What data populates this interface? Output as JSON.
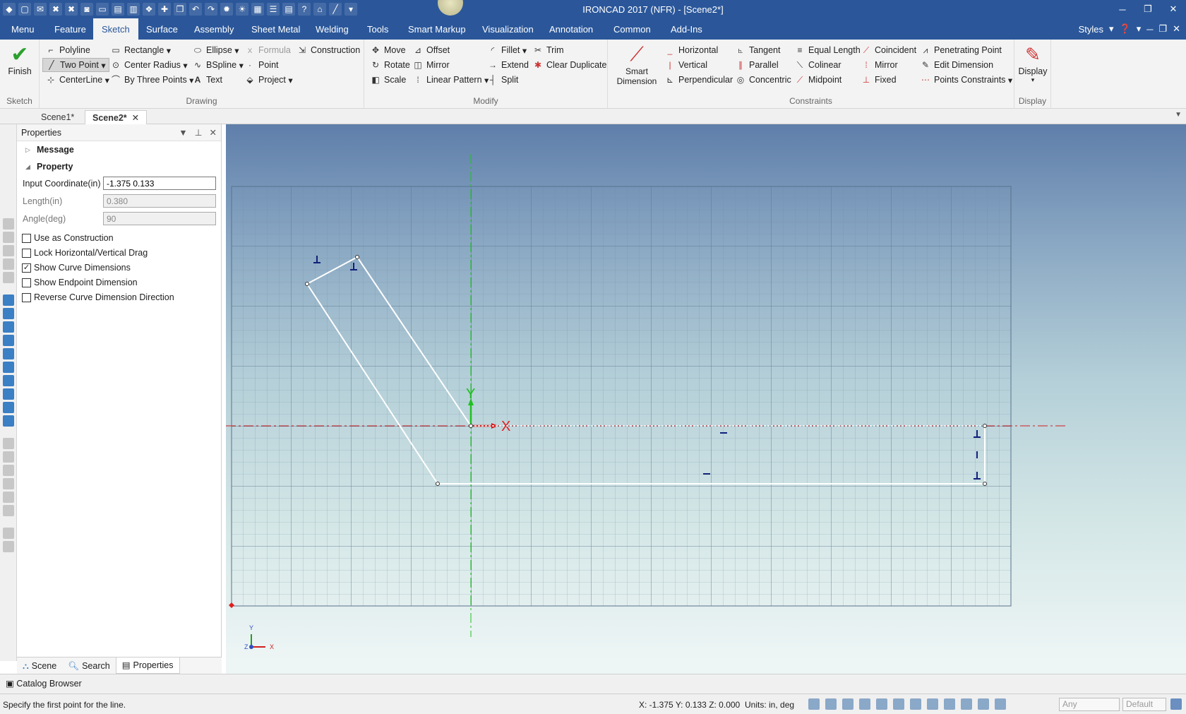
{
  "window": {
    "title": "IRONCAD 2017 (NFR) - [Scene2*]"
  },
  "menu": {
    "tabs": [
      "Menu",
      "Feature",
      "Sketch",
      "Surface",
      "Assembly",
      "Sheet Metal",
      "Welding",
      "Tools",
      "Smart Markup",
      "Visualization",
      "Annotation",
      "Common",
      "Add-Ins"
    ],
    "active": "Sketch",
    "styles_label": "Styles"
  },
  "ribbon": {
    "sketch_group": {
      "finish": "Finish",
      "label": "Sketch"
    },
    "drawing": {
      "polyline": "Polyline",
      "two_point": "Two Point",
      "centerline": "CenterLine",
      "rectangle": "Rectangle",
      "center_radius": "Center Radius",
      "by_three_points": "By Three Points",
      "ellipse": "Ellipse",
      "bspline": "BSpline",
      "text": "Text",
      "formula": "Formula",
      "point": "Point",
      "project": "Project",
      "construction": "Construction",
      "label": "Drawing"
    },
    "modify": {
      "move": "Move",
      "rotate": "Rotate",
      "scale": "Scale",
      "offset": "Offset",
      "mirror": "Mirror",
      "linear_pattern": "Linear Pattern",
      "fillet": "Fillet",
      "extend": "Extend",
      "split": "Split",
      "trim": "Trim",
      "clear_duplicate": "Clear Duplicate",
      "label": "Modify"
    },
    "constraints": {
      "smart_dimension": "Smart Dimension",
      "horizontal": "Horizontal",
      "vertical": "Vertical",
      "perpendicular": "Perpendicular",
      "tangent": "Tangent",
      "parallel": "Parallel",
      "concentric": "Concentric",
      "equal_length": "Equal Length",
      "colinear": "Colinear",
      "midpoint": "Midpoint",
      "coincident": "Coincident",
      "mirror": "Mirror",
      "fixed": "Fixed",
      "penetrating_point": "Penetrating Point",
      "edit_dimension": "Edit Dimension",
      "points_constraints": "Points Constraints",
      "label": "Constraints"
    },
    "display": {
      "display": "Display",
      "label": "Display"
    }
  },
  "doc_tabs": [
    "Scene1*",
    "Scene2*"
  ],
  "properties": {
    "title": "Properties",
    "message_section": "Message",
    "property_section": "Property",
    "fields": [
      {
        "label": "Input Coordinate(in)",
        "value": "-1.375 0.133",
        "enabled": true
      },
      {
        "label": "Length(in)",
        "value": "0.380",
        "enabled": false
      },
      {
        "label": "Angle(deg)",
        "value": "90",
        "enabled": false
      }
    ],
    "checkboxes": [
      {
        "label": "Use as Construction",
        "checked": false
      },
      {
        "label": "Lock Horizontal/Vertical Drag",
        "checked": false
      },
      {
        "label": "Show Curve Dimensions",
        "checked": true
      },
      {
        "label": "Show Endpoint Dimension",
        "checked": false
      },
      {
        "label": "Reverse Curve Dimension Direction",
        "checked": false
      }
    ],
    "bottom_tabs": [
      "Scene",
      "Search",
      "Properties"
    ]
  },
  "viewport": {
    "x_axis_label": "X",
    "y_axis_label": "Y",
    "triad": {
      "x": "X",
      "y": "Y",
      "z": "Z"
    }
  },
  "catalog": {
    "label": "Catalog Browser"
  },
  "status": {
    "message": "Specify the first point for the line.",
    "coords": "X: -1.375 Y: 0.133 Z: 0.000",
    "units": "Units: in, deg",
    "filter": "Any",
    "style": "Default"
  }
}
